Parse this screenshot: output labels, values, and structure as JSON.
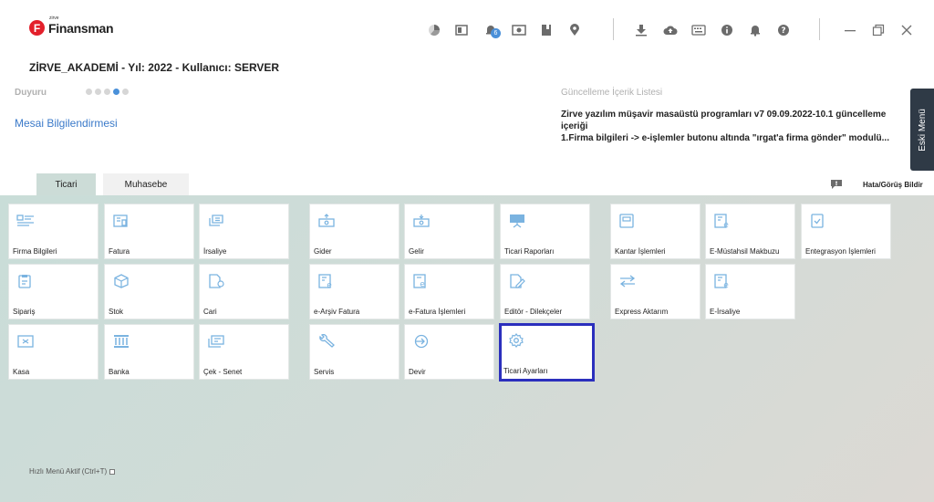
{
  "app": {
    "logo_small": "zirve",
    "logo_main": "Finansman",
    "logo_letter": "F"
  },
  "toolbar": {
    "icons": [
      "pie-chart-icon",
      "book-icon",
      "bell-badge-icon",
      "money-icon",
      "bookmark-icon",
      "location-pin-icon",
      "download-icon",
      "cloud-upload-icon",
      "keyboard-icon",
      "info-icon",
      "bell-icon",
      "help-icon"
    ],
    "notification_badge": "6"
  },
  "header": {
    "company_line": "ZİRVE_AKADEMİ - Yıl: 2022 - Kullanıcı: SERVER",
    "duyuru_label": "Duyuru",
    "mesai_link": "Mesai Bilgilendirmesi",
    "update_title": "Güncelleme İçerik Listesi",
    "update_line1": "Zirve yazılım müşavir masaüstü programları v7 09.09.2022-10.1 güncelleme içeriği",
    "update_line2": "1.Firma bilgileri -> e-işlemler butonu altında \"ırgat'a firma gönder\" modulü...",
    "eski_menu": "Eski Menü"
  },
  "tabs": {
    "ticari": "Ticari",
    "muhasebe": "Muhasebe"
  },
  "feedback_label": "Hata/Görüş Bildir",
  "tiles": {
    "firma": "Firma Bilgileri",
    "fatura": "Fatura",
    "irsaliye": "İrsaliye",
    "gider": "Gider",
    "gelir": "Gelir",
    "ticari_raporlar": "Ticari Raporları",
    "kantar": "Kantar İşlemleri",
    "mustahsil": "E-Müstahsil Makbuzu",
    "entegrasyon": "Entegrasyon İşlemleri",
    "siparis": "Sipariş",
    "stok": "Stok",
    "cari": "Cari",
    "earsiv": "e-Arşiv Fatura",
    "efatura": "e-Fatura İşlemleri",
    "editor": "Editör - Dilekçeler",
    "express": "Express Aktarım",
    "eirsaliye": "E-İrsaliye",
    "kasa": "Kasa",
    "banka": "Banka",
    "cek": "Çek - Senet",
    "servis": "Servis",
    "devir": "Devir",
    "ayarlar": "Ticari Ayarları"
  },
  "selected_tile": "Ticari Ayarları",
  "hizli_menu": "Hızlı Menü Aktif (Ctrl+T)",
  "colors": {
    "accent_blue": "#4a90d9",
    "icon_blue": "#7ab3e0",
    "selection_border": "#2b2fbd",
    "brand_red": "#e3202b",
    "eski_menu_bg": "#2f3a46"
  }
}
